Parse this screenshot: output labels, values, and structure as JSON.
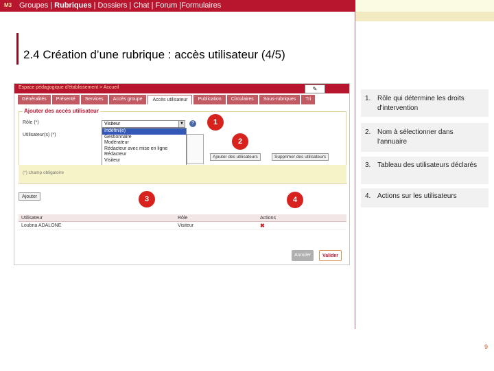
{
  "header": {
    "module": "M3",
    "nav": [
      {
        "label": "Groupes |",
        "active": false
      },
      {
        "label": "Rubriques",
        "active": true
      },
      {
        "label": "| Dossiers | Chat | Forum |Formulaires",
        "active": false
      }
    ]
  },
  "title": "2.4 Création d’une rubrique : accès utilisateur (4/5)",
  "shot": {
    "breadcrumb": "Espace pédagogique d'établissement > Accueil",
    "tabs": [
      {
        "label": "Généralités",
        "active": false
      },
      {
        "label": "Présenté",
        "active": false
      },
      {
        "label": "Services",
        "active": false
      },
      {
        "label": "Accès groupe",
        "active": false
      },
      {
        "label": "Accès utilisateur",
        "active": true
      },
      {
        "label": "Publication",
        "active": false
      },
      {
        "label": "Circulaires",
        "active": false
      },
      {
        "label": "Sous-rubriques",
        "active": false
      },
      {
        "label": "Tri",
        "active": false
      }
    ],
    "fieldset_legend": "Ajouter des accès utilisateur",
    "role_label": "Rôle (*)",
    "role_selected": "Visiteur",
    "users_label": "Utilisateur(s) (*)",
    "role_options": [
      "Indéfini(e)",
      "Gestionnaire",
      "Modérateur",
      "Rédacteur avec mise en ligne",
      "Rédacteur",
      "Visiteur"
    ],
    "add_users_btn": "Ajouter des utilisateurs",
    "remove_users_btn": "Supprimer des utilisateurs",
    "required_note": "(*) champ obligatoire",
    "add_btn": "Ajouter",
    "table": {
      "headers": [
        "Utilisateur",
        "Rôle",
        "Actions"
      ],
      "rows": [
        {
          "user": "Loubna ADALONE",
          "role": "Visiteur"
        }
      ]
    },
    "cancel_btn": "Annuler",
    "validate_btn": "Valider"
  },
  "badges": [
    "1",
    "2",
    "3",
    "4"
  ],
  "notes": [
    {
      "num": "1.",
      "text": "Rôle qui détermine les droits d'intervention"
    },
    {
      "num": "2.",
      "text": "Nom à sélectionner dans l'annuaire"
    },
    {
      "num": "3.",
      "text": "Tableau des utilisateurs déclarés"
    },
    {
      "num": "4.",
      "text": "Actions sur les utilisateurs"
    }
  ],
  "page_number": "9",
  "colors": {
    "brand": "#b8162f",
    "badge": "#d7221d",
    "note_bg": "#f1f1f1"
  },
  "icons": [
    "help-icon",
    "delete-x-icon",
    "dropdown-arrow-icon",
    "editor-icon"
  ]
}
